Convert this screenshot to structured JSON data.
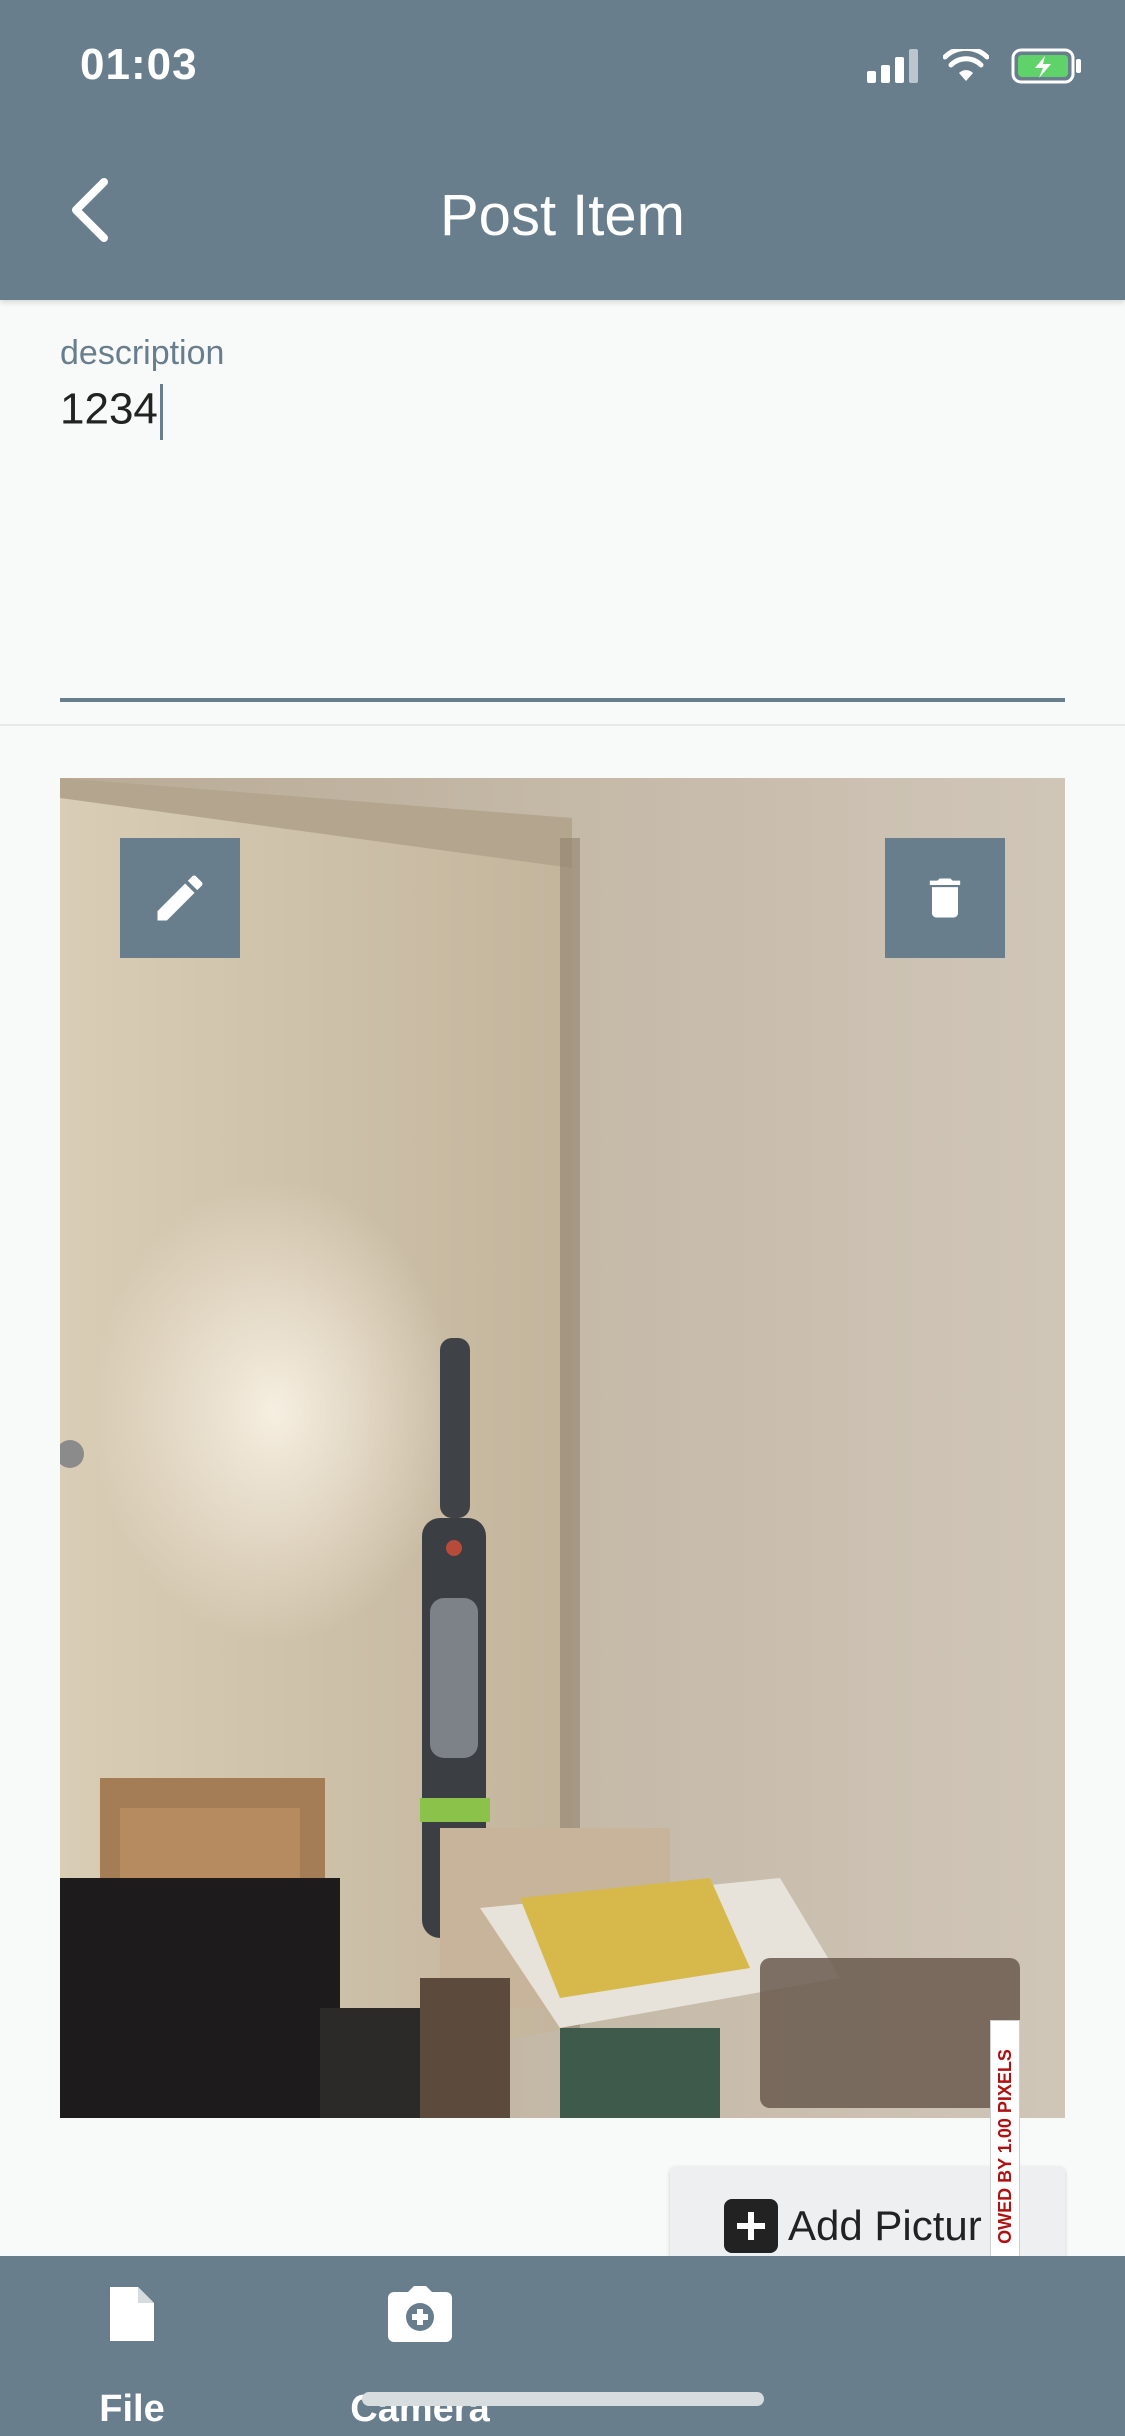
{
  "status_bar": {
    "time": "01:03"
  },
  "nav": {
    "title": "Post Item"
  },
  "description": {
    "label": "description",
    "value": "1234"
  },
  "photo": {
    "edit_icon": "pencil-icon",
    "delete_icon": "trash-icon"
  },
  "add_picture": {
    "label": "Add Pictur"
  },
  "watermark": {
    "text": "OWED BY 1.00 PIXELS"
  },
  "toolbar": {
    "file_label": "File",
    "camera_label": "Camera"
  },
  "colors": {
    "primary": "#687e8d",
    "background": "#f8f9f9",
    "battery_green": "#5fd36a"
  }
}
